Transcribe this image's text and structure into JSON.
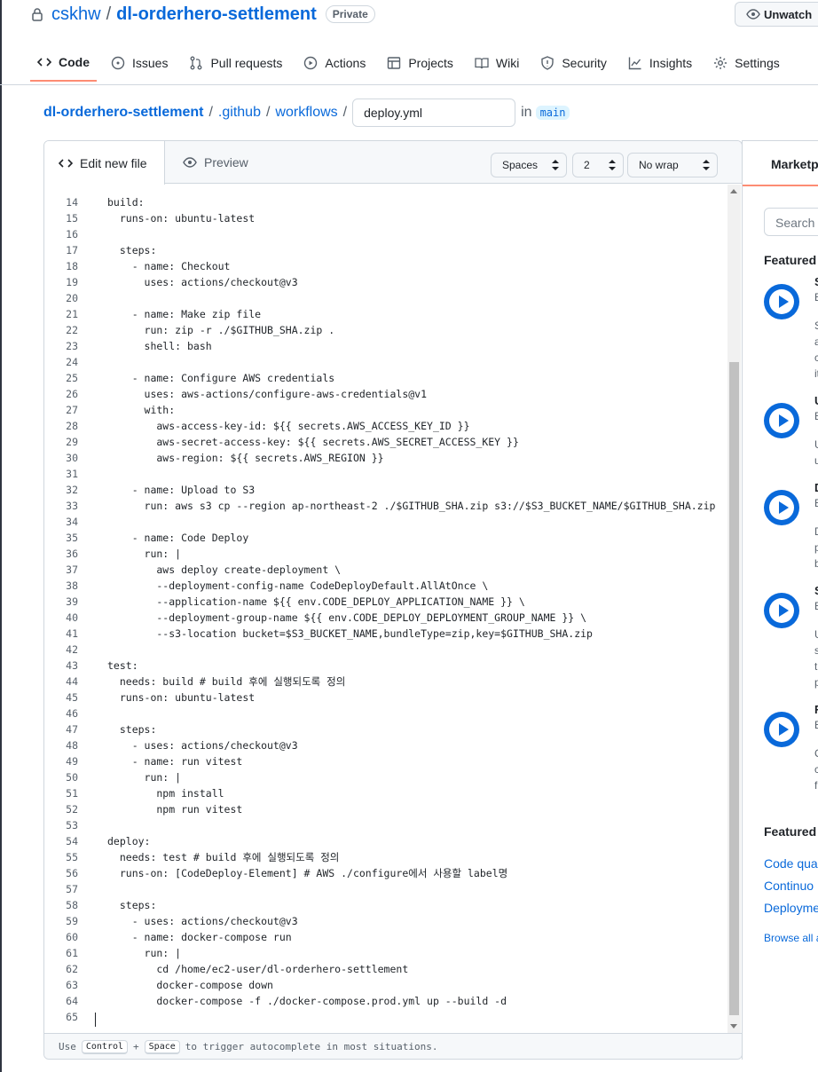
{
  "repo": {
    "owner": "cskhw",
    "sep": "/",
    "name": "dl-orderhero-settlement",
    "visibility": "Private",
    "unwatch_label": "Unwatch"
  },
  "tabs": [
    {
      "label": "Code",
      "icon": "code-icon"
    },
    {
      "label": "Issues",
      "icon": "issue-icon"
    },
    {
      "label": "Pull requests",
      "icon": "pull-request-icon"
    },
    {
      "label": "Actions",
      "icon": "play-icon"
    },
    {
      "label": "Projects",
      "icon": "table-icon"
    },
    {
      "label": "Wiki",
      "icon": "book-icon"
    },
    {
      "label": "Security",
      "icon": "shield-icon"
    },
    {
      "label": "Insights",
      "icon": "graph-icon"
    },
    {
      "label": "Settings",
      "icon": "gear-icon"
    }
  ],
  "breadcrumb": {
    "root": "dl-orderhero-settlement",
    "dir1": ".github",
    "dir2": "workflows",
    "sep": "/",
    "filename": "deploy.yml",
    "in_label": "in",
    "branch": "main"
  },
  "editor": {
    "edit_tab": "Edit new file",
    "preview_tab": "Preview",
    "indent_mode": "Spaces",
    "indent_size": "2",
    "wrap_mode": "No wrap",
    "footer": {
      "use": "Use",
      "key1": "Control",
      "plus": "+",
      "key2": "Space",
      "rest": "to trigger autocomplete in most situations."
    }
  },
  "code_lines": [
    {
      "n": "14",
      "t": "build:"
    },
    {
      "n": "15",
      "t": "  runs-on: ubuntu-latest"
    },
    {
      "n": "16",
      "t": ""
    },
    {
      "n": "17",
      "t": "  steps:"
    },
    {
      "n": "18",
      "t": "    - name: Checkout"
    },
    {
      "n": "19",
      "t": "      uses: actions/checkout@v3"
    },
    {
      "n": "20",
      "t": ""
    },
    {
      "n": "21",
      "t": "    - name: Make zip file"
    },
    {
      "n": "22",
      "t": "      run: zip -r ./$GITHUB_SHA.zip ."
    },
    {
      "n": "23",
      "t": "      shell: bash"
    },
    {
      "n": "24",
      "t": ""
    },
    {
      "n": "25",
      "t": "    - name: Configure AWS credentials"
    },
    {
      "n": "26",
      "t": "      uses: aws-actions/configure-aws-credentials@v1"
    },
    {
      "n": "27",
      "t": "      with:"
    },
    {
      "n": "28",
      "t": "        aws-access-key-id: ${{ secrets.AWS_ACCESS_KEY_ID }}"
    },
    {
      "n": "29",
      "t": "        aws-secret-access-key: ${{ secrets.AWS_SECRET_ACCESS_KEY }}"
    },
    {
      "n": "30",
      "t": "        aws-region: ${{ secrets.AWS_REGION }}"
    },
    {
      "n": "31",
      "t": ""
    },
    {
      "n": "32",
      "t": "    - name: Upload to S3"
    },
    {
      "n": "33",
      "t": "      run: aws s3 cp --region ap-northeast-2 ./$GITHUB_SHA.zip s3://$S3_BUCKET_NAME/$GITHUB_SHA.zip"
    },
    {
      "n": "34",
      "t": ""
    },
    {
      "n": "35",
      "t": "    - name: Code Deploy"
    },
    {
      "n": "36",
      "t": "      run: |"
    },
    {
      "n": "37",
      "t": "        aws deploy create-deployment \\"
    },
    {
      "n": "38",
      "t": "        --deployment-config-name CodeDeployDefault.AllAtOnce \\"
    },
    {
      "n": "39",
      "t": "        --application-name ${{ env.CODE_DEPLOY_APPLICATION_NAME }} \\"
    },
    {
      "n": "40",
      "t": "        --deployment-group-name ${{ env.CODE_DEPLOY_DEPLOYMENT_GROUP_NAME }} \\"
    },
    {
      "n": "41",
      "t": "        --s3-location bucket=$S3_BUCKET_NAME,bundleType=zip,key=$GITHUB_SHA.zip"
    },
    {
      "n": "42",
      "t": ""
    },
    {
      "n": "43",
      "t": "test:"
    },
    {
      "n": "44",
      "t": "  needs: build # build 후에 실행되도록 정의"
    },
    {
      "n": "45",
      "t": "  runs-on: ubuntu-latest"
    },
    {
      "n": "46",
      "t": ""
    },
    {
      "n": "47",
      "t": "  steps:"
    },
    {
      "n": "48",
      "t": "    - uses: actions/checkout@v3"
    },
    {
      "n": "49",
      "t": "    - name: run vitest"
    },
    {
      "n": "50",
      "t": "      run: |"
    },
    {
      "n": "51",
      "t": "        npm install"
    },
    {
      "n": "52",
      "t": "        npm run vitest"
    },
    {
      "n": "53",
      "t": ""
    },
    {
      "n": "54",
      "t": "deploy:"
    },
    {
      "n": "55",
      "t": "  needs: test # build 후에 실행되도록 정의"
    },
    {
      "n": "56",
      "t": "  runs-on: [CodeDeploy-Element] # AWS ./configure에서 사용할 label명"
    },
    {
      "n": "57",
      "t": ""
    },
    {
      "n": "58",
      "t": "  steps:"
    },
    {
      "n": "59",
      "t": "    - uses: actions/checkout@v3"
    },
    {
      "n": "60",
      "t": "    - name: docker-compose run"
    },
    {
      "n": "61",
      "t": "      run: |"
    },
    {
      "n": "62",
      "t": "        cd /home/ec2-user/dl-orderhero-settlement"
    },
    {
      "n": "63",
      "t": "        docker-compose down"
    },
    {
      "n": "64",
      "t": "        docker-compose -f ./docker-compose.prod.yml up --build -d"
    },
    {
      "n": "65",
      "t": ""
    }
  ],
  "sidebar": {
    "tab": "Marketp",
    "search_placeholder": "Search M",
    "featured_actions": "Featured A",
    "actions": [
      {
        "t": "S",
        "b": "B",
        "d": [
          "S",
          "a",
          "c",
          "it"
        ]
      },
      {
        "t": "U",
        "b": "B",
        "d": [
          "U",
          "u"
        ]
      },
      {
        "t": "D",
        "b": "B",
        "d": [
          "D",
          "p",
          "b"
        ]
      },
      {
        "t": "S",
        "b": "B",
        "d": [
          "U",
          "s",
          "t",
          "p"
        ]
      },
      {
        "t": "F",
        "b": "B",
        "d": [
          "C",
          "c",
          "f"
        ]
      }
    ],
    "featured_categories": "Featured c",
    "categories": [
      "Code qua",
      "Continuo",
      "Deployme"
    ],
    "browse_all": "Browse all a"
  }
}
